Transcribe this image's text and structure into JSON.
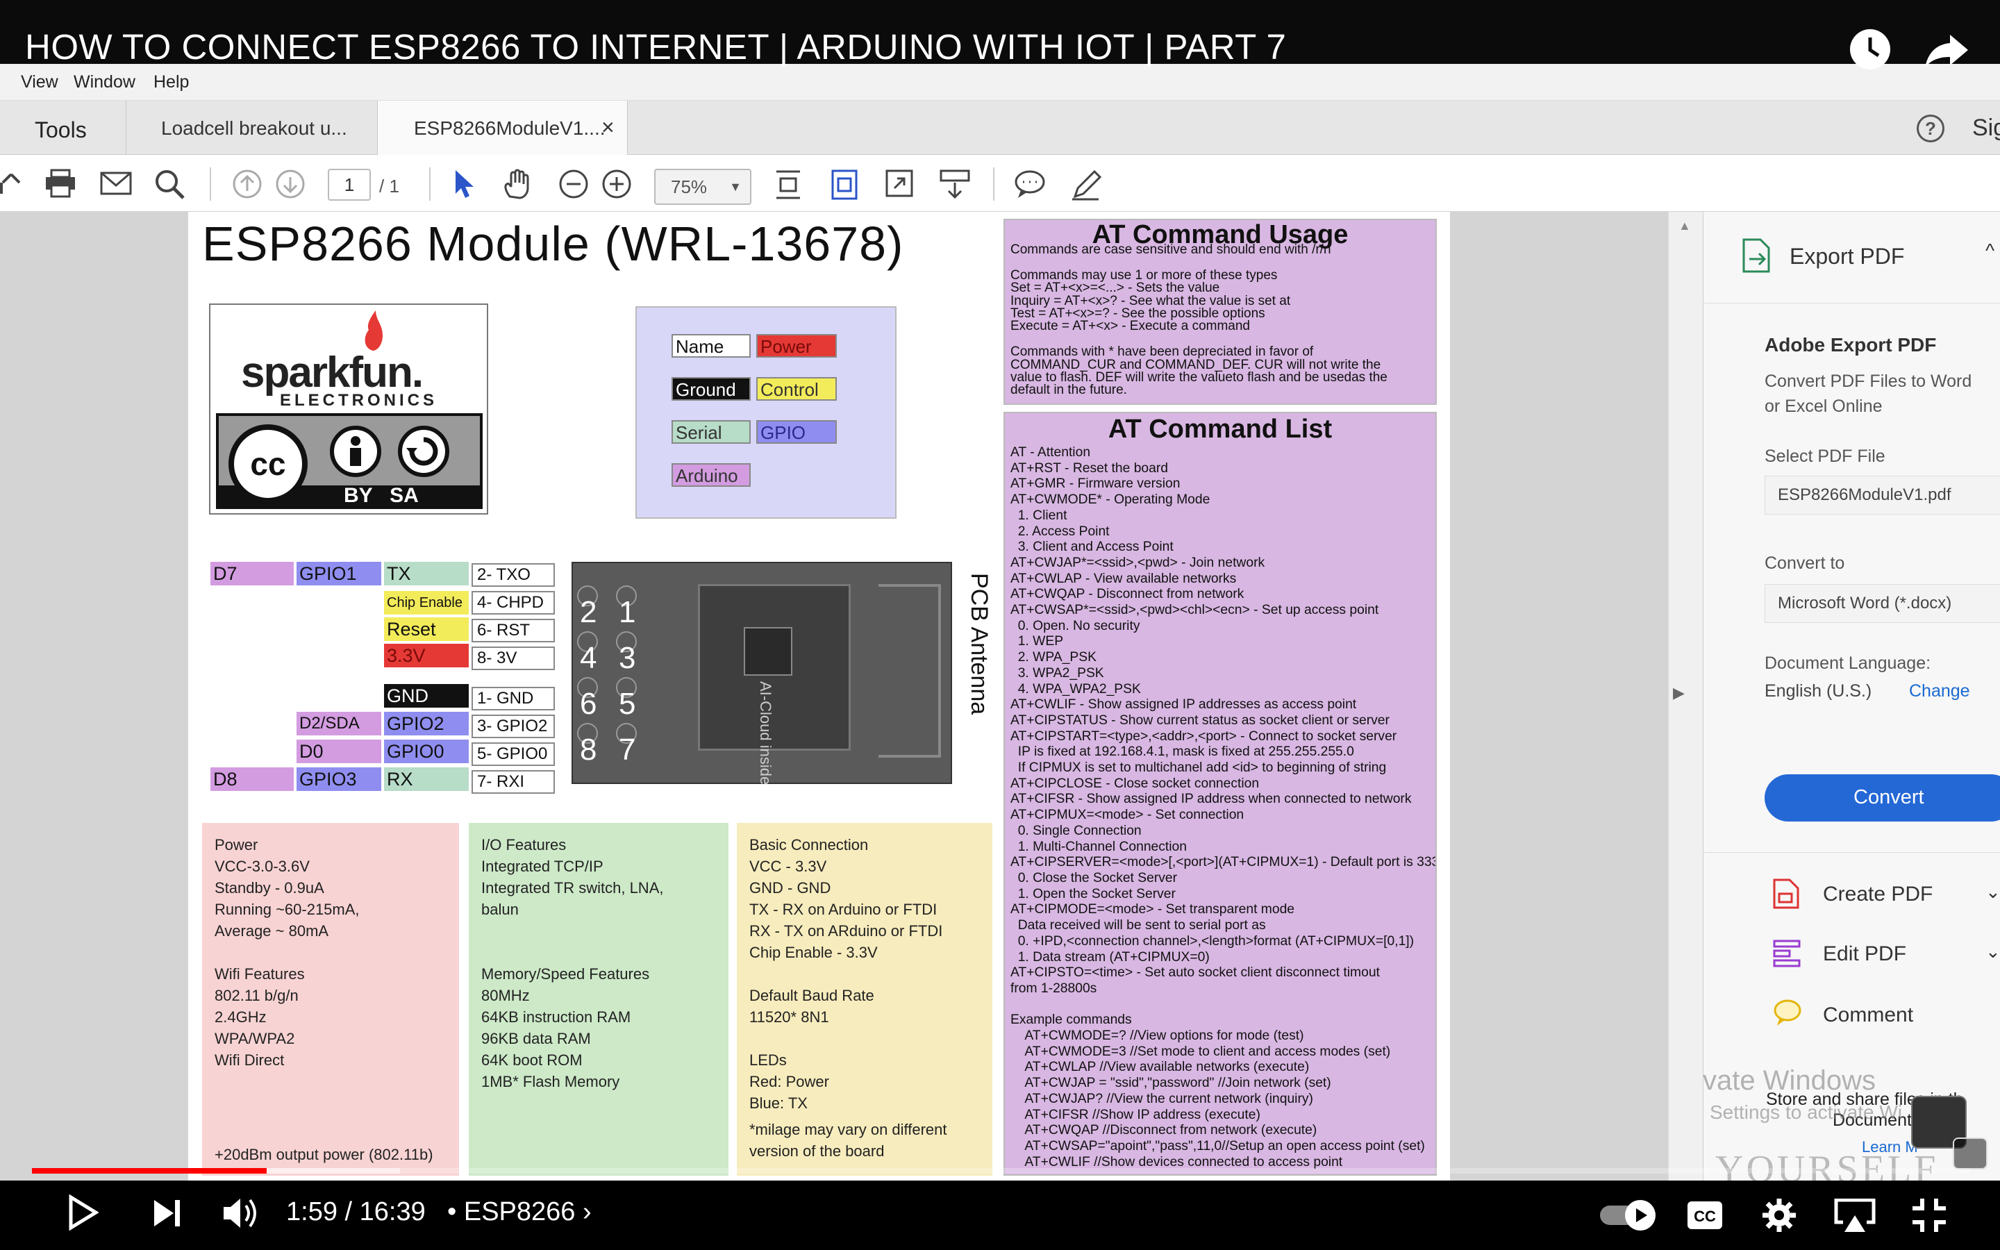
{
  "video": {
    "title": "HOW TO CONNECT ESP8266 TO INTERNET | ARDUINO WITH IOT | PART 7",
    "time": "1:59 / 16:39",
    "chapter": "• ESP8266",
    "progress": 0.121,
    "buffered": 0.19
  },
  "acrobat": {
    "menu": [
      "View",
      "Window",
      "Help"
    ],
    "tabs": {
      "tools": "Tools",
      "tab1": "Loadcell breakout u...",
      "tab2": "ESP8266ModuleV1....",
      "close": "×"
    },
    "toolbar": {
      "page_current": "1",
      "page_total": "/ 1",
      "zoom": "75%"
    },
    "right_edge_text": "Sig",
    "panel": {
      "export_title": "Export PDF",
      "heading": "Adobe Export PDF",
      "desc1": "Convert PDF Files to Word",
      "desc2": "or Excel Online",
      "select_label": "Select PDF File",
      "file_name": "ESP8266ModuleV1.pdf",
      "convert_to_label": "Convert to",
      "convert_to_value": "Microsoft Word (*.docx)",
      "lang_label": "Document Language:",
      "lang_value": "English (U.S.)",
      "lang_change": "Change",
      "convert_button": "Convert",
      "create_pdf": "Create PDF",
      "edit_pdf": "Edit PDF",
      "comment": "Comment",
      "store": "Store and share files in th",
      "store2": "Document Cloud",
      "learn": "Learn M"
    },
    "watermark": {
      "line1": "vate Windows",
      "line2": "Settings to activate Wi",
      "yourself": "YOURSELF"
    }
  },
  "doc": {
    "title": "ESP8266 Module (WRL-13678)",
    "logo": {
      "brand": "sparkfun.",
      "sub": "ELECTRONICS",
      "license": "BY   SA",
      "cc": "cc"
    },
    "legend": [
      {
        "label": "Name",
        "color": "#ffffff",
        "text": "#111"
      },
      {
        "label": "Power",
        "color": "#e53935",
        "text": "#7a0a0a"
      },
      {
        "label": "Ground",
        "color": "#111111",
        "text": "#ffffff"
      },
      {
        "label": "Control",
        "color": "#f3ec5a",
        "text": "#333"
      },
      {
        "label": "Serial",
        "color": "#b7dcc8",
        "text": "#333"
      },
      {
        "label": "GPIO",
        "color": "#8f8ef0",
        "text": "#2a2a8a"
      },
      {
        "label": "Arduino",
        "color": "#d39ce0",
        "text": "#333"
      }
    ],
    "pins_left": {
      "d7": "D7",
      "gpio1": "GPIO1",
      "tx": "TX",
      "chip_enable": "Chip Enable",
      "reset": "Reset",
      "v33": "3.3V",
      "gnd": "GND",
      "d2sda": "D2/SDA",
      "gpio2": "GPIO2",
      "d0": "D0",
      "gpio0": "GPIO0",
      "d8": "D8",
      "gpio3": "GPIO3",
      "rx": "RX"
    },
    "pin_numbers": [
      "2- TXO",
      "4- CHPD",
      "6- RST",
      "8- 3V",
      "1- GND",
      "3- GPIO2",
      "5- GPIO0",
      "7- RXI"
    ],
    "module": {
      "nums": [
        "2",
        "1",
        "4",
        "3",
        "6",
        "5",
        "8",
        "7"
      ],
      "antenna": "PCB Antenna",
      "chip": "AI-Cloud inside"
    },
    "features": {
      "power": "Power\nVCC-3.0-3.6V\nStandby - 0.9uA\nRunning ~60-215mA,\nAverage ~ 80mA\n\nWifi Features\n802.11 b/g/n\n2.4GHz\nWPA/WPA2\nWifi Direct",
      "power_foot": "+20dBm output power (802.11b)",
      "io": "I/O Features\nIntegrated TCP/IP\nIntegrated TR switch, LNA,\nbalun\n\n\nMemory/Speed Features\n80MHz\n64KB instruction RAM\n96KB data RAM\n64K boot ROM\n1MB* Flash Memory",
      "basic": "Basic Connection\nVCC - 3.3V\nGND - GND\nTX - RX on Arduino or FTDI\nRX - TX on ARduino or FTDI\nChip Enable - 3.3V\n\nDefault Baud Rate\n11520* 8N1\n\nLEDs\nRed: Power\nBlue: TX",
      "basic_foot": "*milage may vary on different\nversion of the board"
    },
    "at_usage": {
      "title": "AT Command Usage",
      "body": "Commands are case sensitive and should end with /r/n\n\nCommands may use 1 or more of these types\nSet = AT+<x>=<...> - Sets the value\nInquiry = AT+<x>? - See what the value is set at\nTest = AT+<x>=? - See the possible options\nExecute = AT+<x> - Execute a command\n\nCommands with * have been depreciated in favor of\nCOMMAND_CUR and COMMAND_DEF. CUR will not write the\nvalue to flash. DEF will write the valueto flash and be usedas the\ndefault in the future."
    },
    "at_list": {
      "title": "AT Command List",
      "body": "AT - Attention\nAT+RST - Reset the board\nAT+GMR - Firmware version\nAT+CWMODE* - Operating Mode\n  1. Client\n  2. Access Point\n  3. Client and Access Point\nAT+CWJAP*=<ssid>,<pwd> - Join network\nAT+CWLAP - View available networks\nAT+CWQAP - Disconnect from network\nAT+CWSAP*=<ssid>,<pwd><chl><ecn> - Set up access point\n  0. Open. No security\n  1. WEP\n  2. WPA_PSK\n  3. WPA2_PSK\n  4. WPA_WPA2_PSK\nAT+CWLIF - Show assigned IP addresses as access point\nAT+CIPSTATUS - Show current status as socket client or server\nAT+CIPSTART=<type>,<addr>,<port> - Connect to socket server\n  IP is fixed at 192.168.4.1, mask is fixed at 255.255.255.0\n  If CIPMUX is set to multichanel add <id> to beginning of string\nAT+CIPCLOSE - Close socket connection\nAT+CIFSR - Show assigned IP address when connected to network\nAT+CIPMUX=<mode> - Set connection\n  0. Single Connection\n  1. Multi-Channel Connection\nAT+CIPSERVER=<mode>[,<port>](AT+CIPMUX=1) - Default port is 333\n  0. Close the Socket Server\n  1. Open the Socket Server\nAT+CIPMODE=<mode> - Set transparent mode\n  Data received will be sent to serial port as\n  0. +IPD,<connection channel>,<length>format (AT+CIPMUX=[0,1])\n  1. Data stream (AT+CIPMUX=0)\nAT+CIPSTO=<time> - Set auto socket client disconnect timout\nfrom 1-28800s\n\nExample commands\n    AT+CWMODE=? //View options for mode (test)\n    AT+CWMODE=3 //Set mode to client and access modes (set)\n    AT+CWLAP //View available networks (execute)\n    AT+CWJAP = \"ssid\",\"password\" //Join network (set)\n    AT+CWJAP? //View the current network (inquiry)\n    AT+CIFSR //Show IP address (execute)\n    AT+CWQAP //Disconnect from network (execute)\n    AT+CWSAP=\"apoint\",\"pass\",11,0//Setup an open access point (set)\n    AT+CWLIF //Show devices connected to access point"
    }
  }
}
